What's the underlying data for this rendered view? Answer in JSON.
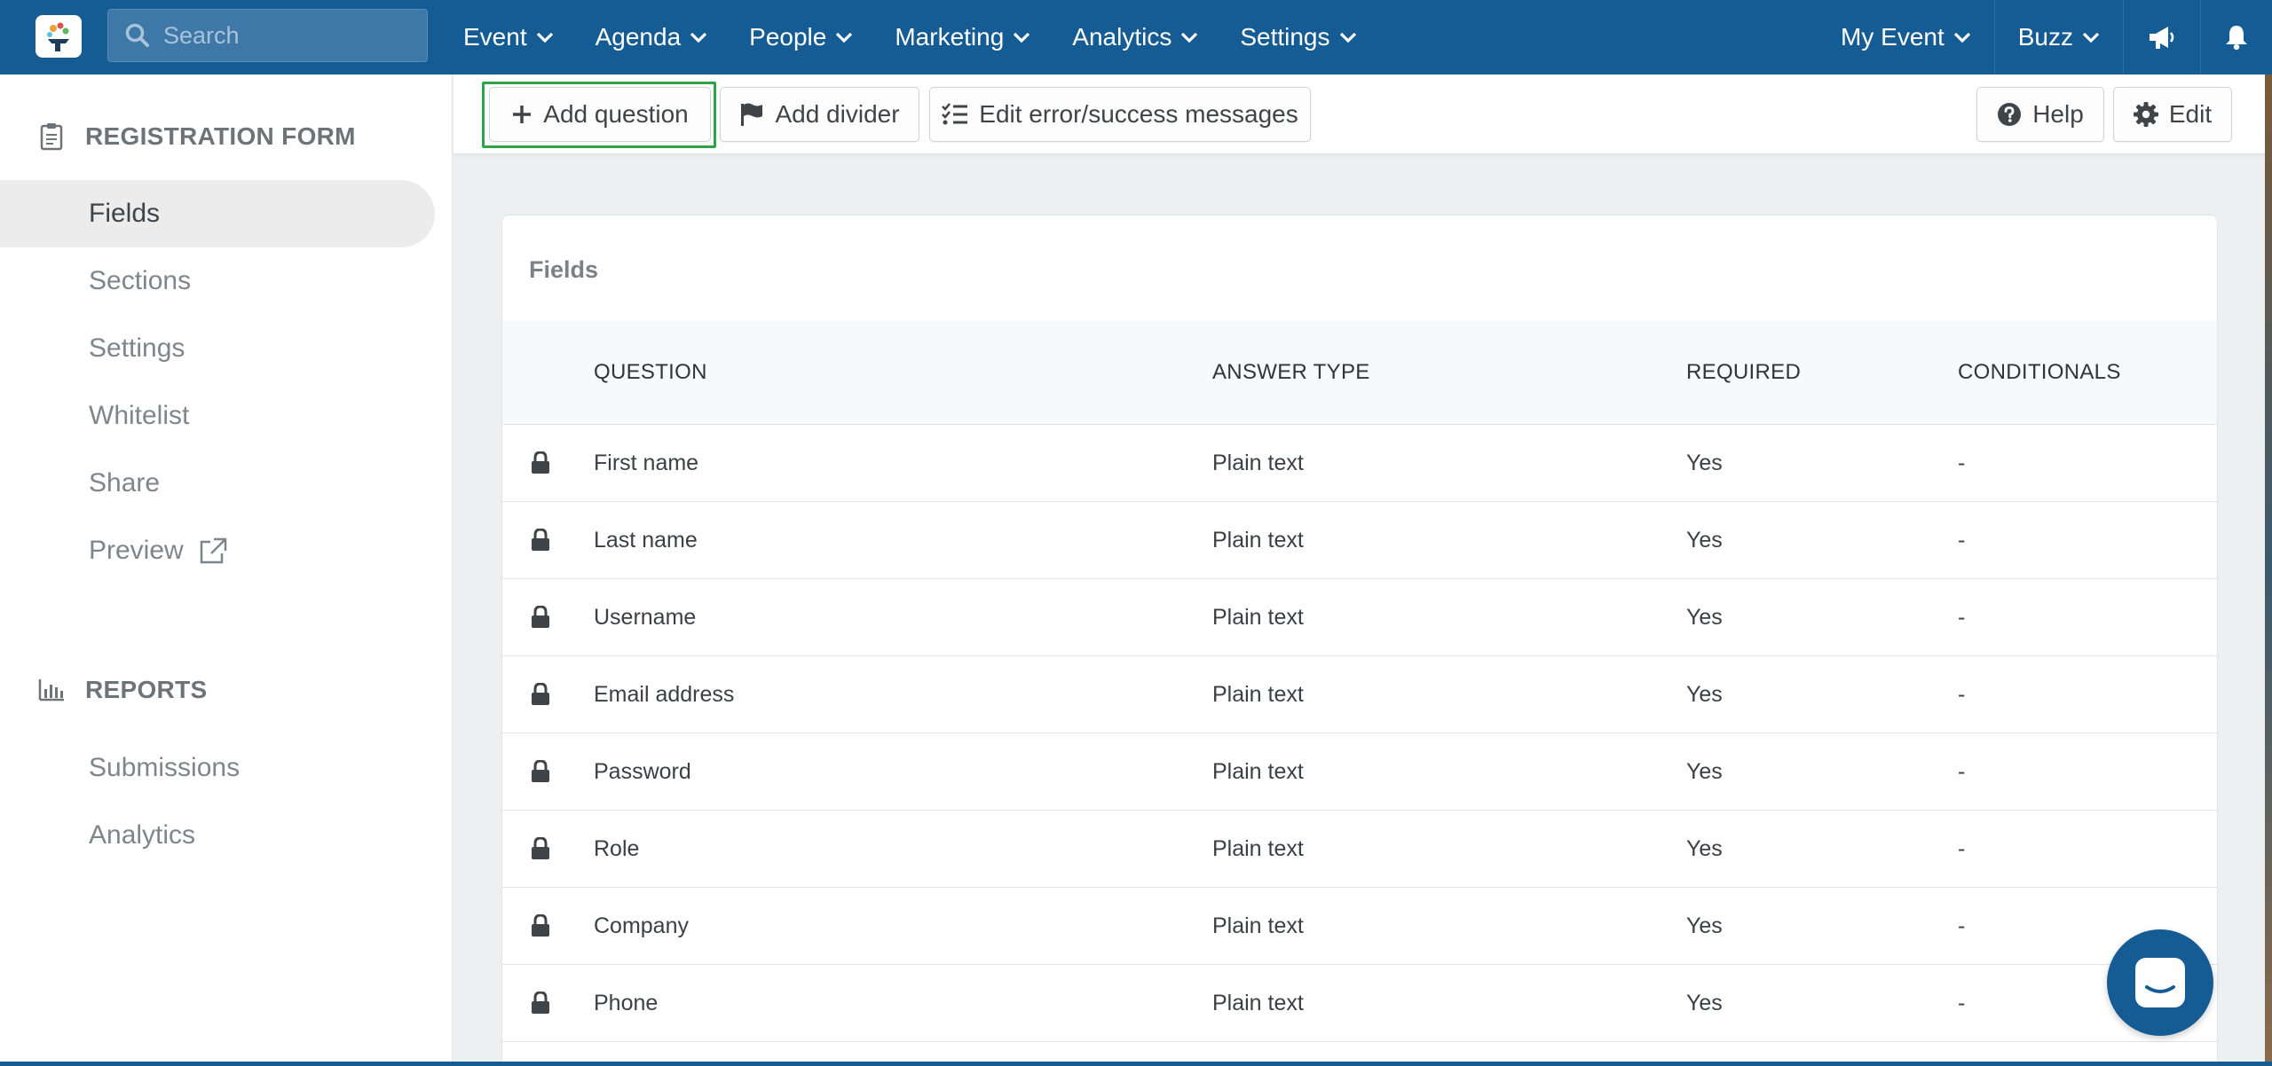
{
  "topbar": {
    "search_placeholder": "Search",
    "menu": [
      {
        "label": "Event"
      },
      {
        "label": "Agenda"
      },
      {
        "label": "People"
      },
      {
        "label": "Marketing"
      },
      {
        "label": "Analytics"
      },
      {
        "label": "Settings"
      }
    ],
    "right": {
      "event_label": "My Event",
      "buzz_label": "Buzz"
    }
  },
  "sidebar": {
    "registration_title": "REGISTRATION FORM",
    "registration_items": [
      {
        "label": "Fields"
      },
      {
        "label": "Sections"
      },
      {
        "label": "Settings"
      },
      {
        "label": "Whitelist"
      },
      {
        "label": "Share"
      },
      {
        "label": "Preview"
      }
    ],
    "reports_title": "REPORTS",
    "reports_items": [
      {
        "label": "Submissions"
      },
      {
        "label": "Analytics"
      }
    ]
  },
  "toolbar": {
    "add_question": "Add question",
    "add_divider": "Add divider",
    "edit_messages": "Edit error/success messages",
    "help": "Help",
    "edit": "Edit"
  },
  "fields_card": {
    "title": "Fields",
    "columns": {
      "question": "QUESTION",
      "answer_type": "ANSWER TYPE",
      "required": "REQUIRED",
      "conditionals": "CONDITIONALS"
    },
    "rows": [
      {
        "question": "First name",
        "answer_type": "Plain text",
        "required": "Yes",
        "conditionals": "-"
      },
      {
        "question": "Last name",
        "answer_type": "Plain text",
        "required": "Yes",
        "conditionals": "-"
      },
      {
        "question": "Username",
        "answer_type": "Plain text",
        "required": "Yes",
        "conditionals": "-"
      },
      {
        "question": "Email address",
        "answer_type": "Plain text",
        "required": "Yes",
        "conditionals": "-"
      },
      {
        "question": "Password",
        "answer_type": "Plain text",
        "required": "Yes",
        "conditionals": "-"
      },
      {
        "question": "Role",
        "answer_type": "Plain text",
        "required": "Yes",
        "conditionals": "-"
      },
      {
        "question": "Company",
        "answer_type": "Plain text",
        "required": "Yes",
        "conditionals": "-"
      },
      {
        "question": "Phone",
        "answer_type": "Plain text",
        "required": "Yes",
        "conditionals": "-"
      }
    ]
  },
  "colors": {
    "brand_blue": "#155c95",
    "highlight_green": "#2ea34a"
  }
}
